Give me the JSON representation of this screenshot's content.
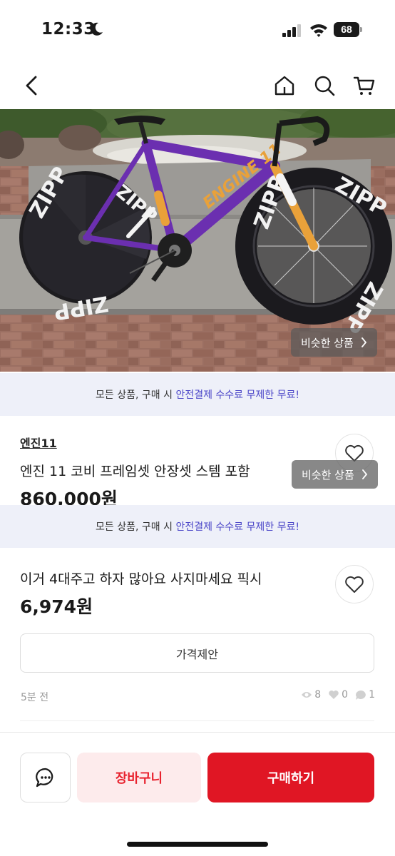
{
  "status_bar": {
    "time": "12:33",
    "battery": "68"
  },
  "nav": {
    "icons": [
      "back-arrow-icon",
      "home-icon",
      "search-icon",
      "cart-icon"
    ]
  },
  "hero": {
    "similar_label": "비슷한 상품"
  },
  "floating_similar": {
    "label": "비슷한 상품"
  },
  "banner": {
    "prefix": "모든 상품, 구매 시 ",
    "highlight": "안전결제 수수료 무제한 무료!"
  },
  "listing_prev": {
    "seller": "엔진11",
    "title": "엔진 11 코비 프레임셋 안장셋 스템 포함",
    "price": "860,000원"
  },
  "listing": {
    "title": "이거 4대주고 하자 많아요 사지마세요 픽시",
    "price": "6,974원",
    "offer_label": "가격제안",
    "time_ago": "5분 전",
    "views": "8",
    "likes": "0",
    "chats": "1"
  },
  "bottom_bar": {
    "cart_label": "장바구니",
    "buy_label": "구매하기"
  },
  "colors": {
    "accent": "#e01624",
    "banner_bg": "#eef0f9",
    "banner_highlight": "#4b46c8"
  }
}
